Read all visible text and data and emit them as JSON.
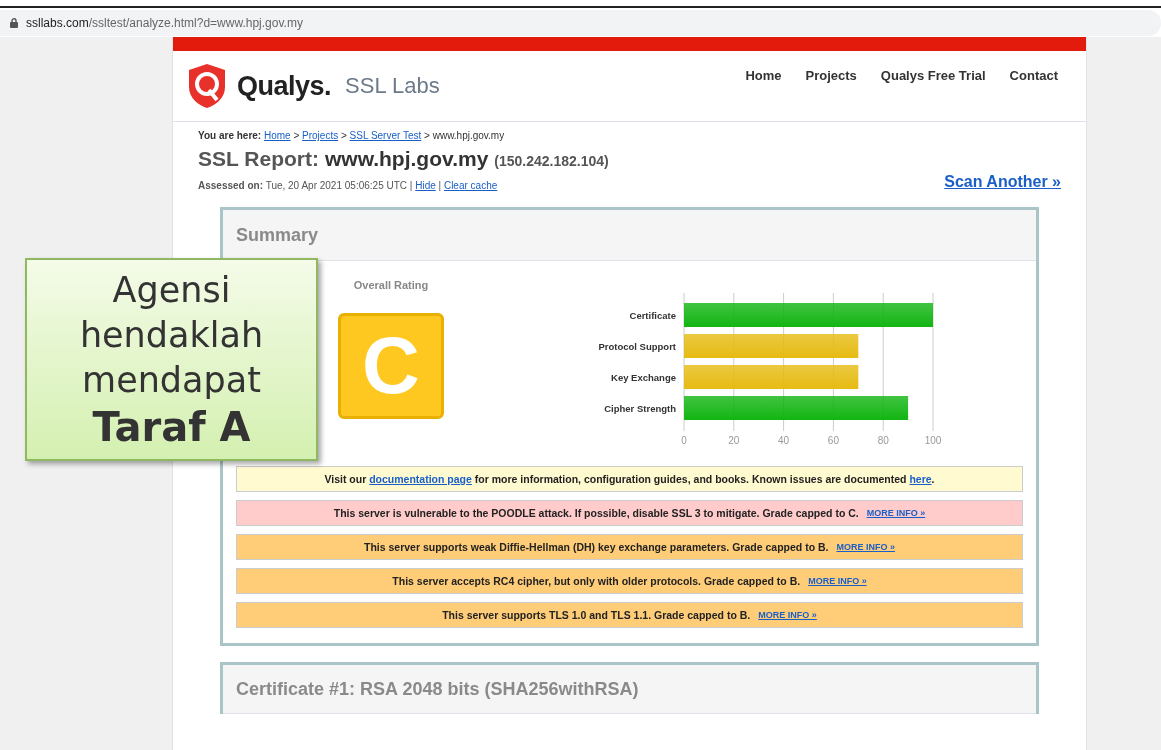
{
  "browser": {
    "url_host": "ssllabs.com",
    "url_path": "/ssltest/analyze.html?d=www.hpj.gov.my"
  },
  "header": {
    "brand": "Qualys.",
    "product": "SSL Labs",
    "nav": [
      {
        "label": "Home"
      },
      {
        "label": "Projects"
      },
      {
        "label": "Qualys Free Trial"
      },
      {
        "label": "Contact"
      }
    ]
  },
  "breadcrumb": {
    "label": "You are here:",
    "items": [
      {
        "label": "Home",
        "link": true
      },
      {
        "label": "Projects",
        "link": true
      },
      {
        "label": "SSL Server Test",
        "link": true
      },
      {
        "label": "www.hpj.gov.my",
        "link": false
      }
    ],
    "separator": ">"
  },
  "report": {
    "title_prefix": "SSL Report:",
    "host": "www.hpj.gov.my",
    "ip": "(150.242.182.104)",
    "assessed_label": "Assessed on:",
    "assessed_value": "Tue, 20 Apr 2021 05:06:25 UTC",
    "divider": "|",
    "actions": [
      "Hide",
      "Clear cache"
    ],
    "scan_another": "Scan Another »"
  },
  "summary": {
    "title": "Summary",
    "rating_label": "Overall Rating",
    "grade": "C",
    "chart_data": {
      "type": "bar",
      "orientation": "horizontal",
      "grid": true,
      "categories": [
        "Certificate",
        "Protocol Support",
        "Key Exchange",
        "Cipher Strength"
      ],
      "series": [
        {
          "color": "#12b512",
          "values": [
            100,
            null,
            null,
            90
          ]
        },
        {
          "color": "#e6bb12",
          "values": [
            null,
            70,
            70,
            null
          ]
        }
      ],
      "xlim": [
        0,
        100
      ],
      "xticks": [
        0,
        20,
        40,
        60,
        80,
        100
      ]
    },
    "notices": [
      {
        "kind": "info",
        "parts": [
          {
            "kind": "text",
            "text": "Visit our "
          },
          {
            "kind": "link",
            "text": "documentation page"
          },
          {
            "kind": "text",
            "text": " for more information, configuration guides, and books. Known issues are documented "
          },
          {
            "kind": "link",
            "text": "here"
          },
          {
            "kind": "text",
            "text": "."
          }
        ]
      },
      {
        "kind": "error",
        "parts": [
          {
            "kind": "text",
            "text": "This server is vulnerable to the POODLE attack. If possible, disable SSL 3 to mitigate. Grade capped to C."
          },
          {
            "kind": "more",
            "text": "MORE INFO »"
          }
        ]
      },
      {
        "kind": "warning",
        "parts": [
          {
            "kind": "text",
            "text": "This server supports weak Diffie-Hellman (DH) key exchange parameters. Grade capped to B."
          },
          {
            "kind": "more",
            "text": "MORE INFO »"
          }
        ]
      },
      {
        "kind": "warning",
        "parts": [
          {
            "kind": "text",
            "text": "This server accepts RC4 cipher, but only with older protocols. Grade capped to B."
          },
          {
            "kind": "more",
            "text": "MORE INFO »"
          }
        ]
      },
      {
        "kind": "warning",
        "parts": [
          {
            "kind": "text",
            "text": "This server supports TLS 1.0 and TLS 1.1. Grade capped to B."
          },
          {
            "kind": "more",
            "text": "MORE INFO »"
          }
        ]
      }
    ]
  },
  "certificate": {
    "title": "Certificate #1: RSA 2048 bits (SHA256withRSA)"
  },
  "callout": {
    "lines": [
      "Agensi",
      "hendaklah",
      "mendapat"
    ],
    "emphasis": "Taraf A"
  }
}
